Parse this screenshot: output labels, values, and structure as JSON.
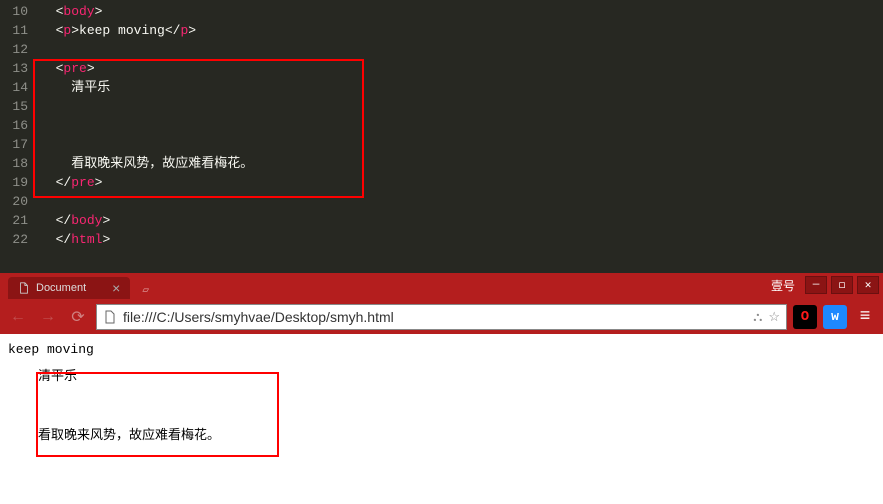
{
  "editor": {
    "lines": {
      "l10": "10",
      "l11": "11",
      "l12": "12",
      "l13": "13",
      "l14": "14",
      "l15": "15",
      "l16": "16",
      "l17": "17",
      "l18": "18",
      "l19": "19",
      "l20": "20",
      "l21": "21",
      "l22": "22"
    },
    "tags": {
      "body_open": "body",
      "p_open": "p",
      "p_close": "p",
      "pre_open": "pre",
      "pre_close": "pre",
      "body_close": "body",
      "html_close": "html"
    },
    "text": {
      "p_content": "keep moving",
      "pre_line1": "    清平乐",
      "pre_line2": "",
      "pre_line3": "",
      "pre_line4": "",
      "pre_line5": "    看取晚来风势，故应难看梅花。"
    }
  },
  "browser": {
    "tab_title": "Document",
    "brand": "壹号",
    "url": "file:///C:/Users/smyhvae/Desktop/smyh.html"
  },
  "page": {
    "p_text": "keep moving",
    "pre_text": "清平乐\n\n\n看取晚来风势，故应难看梅花。"
  }
}
